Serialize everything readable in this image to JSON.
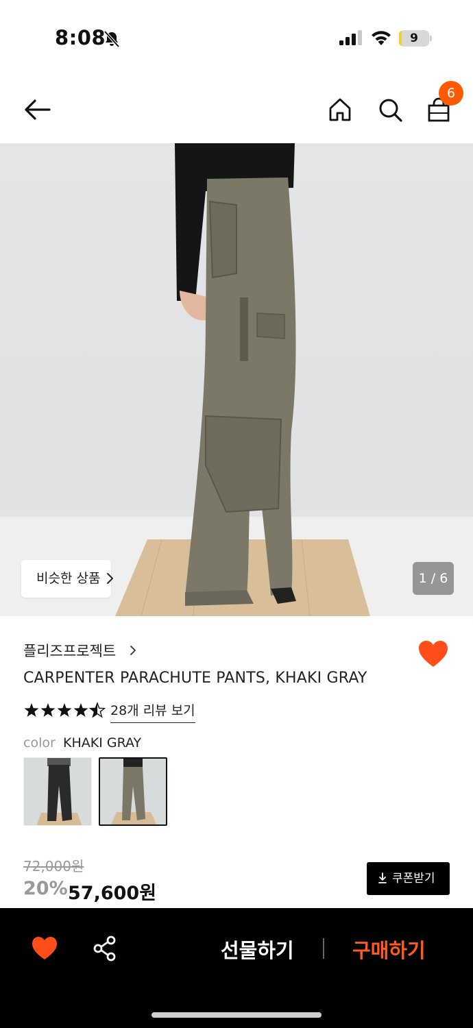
{
  "status_bar": {
    "time": "8:08",
    "battery_level": "9",
    "battery_fraction": 0.09,
    "icons": [
      "bell-off-icon",
      "signal-icon",
      "wifi-icon",
      "battery-icon"
    ]
  },
  "header": {
    "icons": [
      "back-arrow-icon",
      "home-icon",
      "search-icon",
      "shopping-bag-icon"
    ],
    "cart_count": "6"
  },
  "gallery": {
    "similar_button": "비슷한 상품",
    "page_indicator": "1 / 6"
  },
  "product": {
    "brand": "플리즈프로젝트",
    "title": "CARPENTER PARACHUTE PANTS, KHAKI GRAY",
    "rating": 4.5,
    "review_link": "28개 리뷰 보기",
    "color_label": "color",
    "color_value": "KHAKI GRAY",
    "swatches": [
      "black",
      "khaki gray"
    ],
    "selected_swatch": "khaki gray",
    "original_price": "72,000원",
    "discount": "20%",
    "sale_price": "57,600원",
    "coupon_button": "쿠폰받기"
  },
  "bottom_bar": {
    "gift_button": "선물하기",
    "buy_button": "구매하기"
  },
  "colors": {
    "accent": "#ff5a00",
    "heart": "#ff4e1a",
    "buy": "#ff5a1f",
    "bottom_bar": "#000000"
  }
}
